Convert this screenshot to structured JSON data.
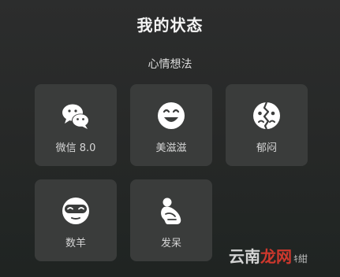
{
  "header": {
    "title": "我的状态"
  },
  "section": {
    "label": "心情想法"
  },
  "tiles": [
    {
      "label": "微信 8.0",
      "icon": "wechat-bubbles-icon"
    },
    {
      "label": "美滋滋",
      "icon": "smiley-face-icon"
    },
    {
      "label": "郁闷",
      "icon": "cracked-face-icon"
    },
    {
      "label": "数羊",
      "icon": "sleep-mask-face-icon"
    },
    {
      "label": "发呆",
      "icon": "crouching-figure-icon"
    }
  ],
  "watermark": {
    "part1": "云南",
    "part2": "龙网",
    "part3": "ｷ紺"
  },
  "colors": {
    "background": "#262827",
    "tile": "#3a3c3b",
    "icon": "#ffffff",
    "watermark_accent": "#e23b2f"
  }
}
